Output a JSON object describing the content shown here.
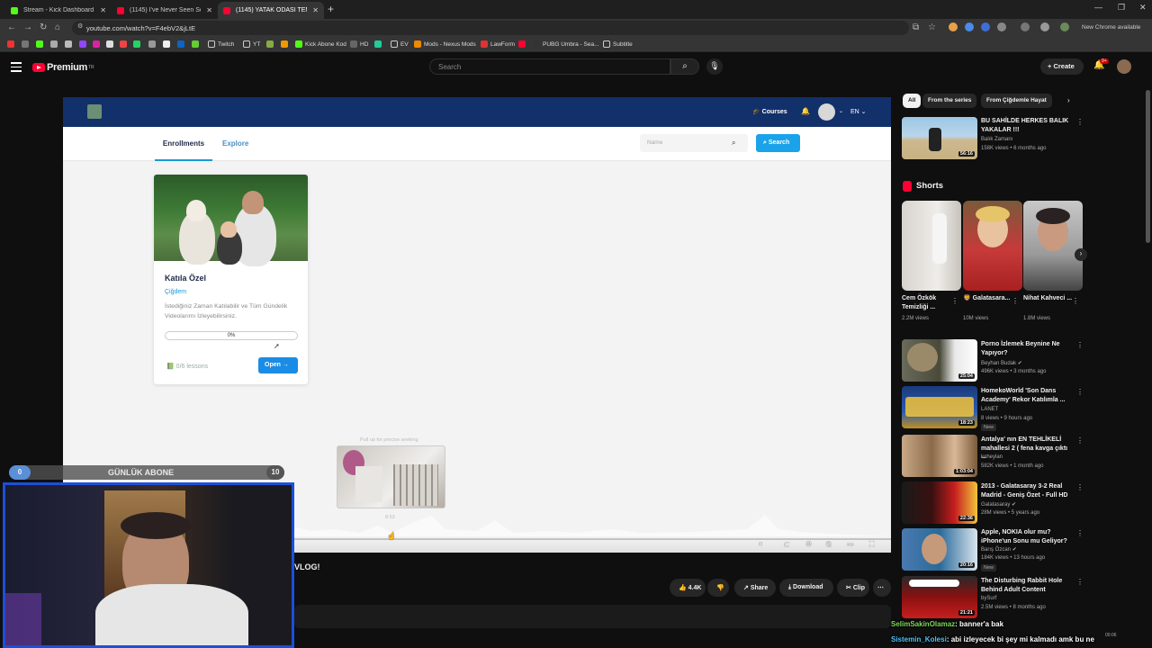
{
  "browser": {
    "tabs": [
      {
        "title": "Stream - Kick Dashboard",
        "color": "#53fc18",
        "active": false
      },
      {
        "title": "(1145) I've Never Seen So Man",
        "color": "#ff0033",
        "active": false
      },
      {
        "title": "(1145) YATAK ODASI TEMİZLİĞİ",
        "color": "#ff0033",
        "active": true
      }
    ],
    "new_tab": "+",
    "url": "youtube.com/watch?v=F4ebV2&jLtE",
    "chrome_update": "New Chrome available",
    "bookmarks": [
      "Twitch",
      "YT",
      "Kick Abone Kod",
      "HD",
      "EV",
      "Mods - Nexus Mods",
      "LawForm",
      "PUBG Umbra - Sea...",
      "Subtitle"
    ]
  },
  "youtube": {
    "logo_text": "Premium",
    "logo_region": "TR",
    "search_placeholder": "Search",
    "create_label": "+ Create",
    "notif_badge": "9+"
  },
  "lms": {
    "nav": {
      "courses": "Courses",
      "lang": "EN"
    },
    "tabs": {
      "enrollments": "Enrollments",
      "explore": "Explore"
    },
    "search_placeholder": "Name",
    "search_button": "Search",
    "card": {
      "title": "Katıla Özel",
      "author": "Çiğdem",
      "desc": "İstediğiniz Zaman Katılabilir ve Tüm Gündelik Videolarımı İzleyebilirsiniz.",
      "progress_label": "0%",
      "progress": 0,
      "lessons": "0/6 lessons",
      "open": "Open"
    }
  },
  "player": {
    "preview_time": "8:53",
    "preview_hint": "Pull up for precise seeking"
  },
  "video": {
    "title_fragment": "VLOG!",
    "actions": {
      "likes": "4.4K",
      "share": "Share",
      "download": "Download",
      "clip": "Clip"
    }
  },
  "sidebar": {
    "chips": [
      "All",
      "From the series",
      "From Çiğdemle Hayat"
    ],
    "top_video": {
      "title": "BU SAHİLDE HERKES BALIK YAKALAR !!!",
      "channel": "Balık Zamanı",
      "meta": "158K views • 6 months ago",
      "duration": "56:16"
    },
    "shorts_label": "Shorts",
    "shorts": [
      {
        "title": "Cem Özkök Temizliği ...",
        "views": "2.2M views"
      },
      {
        "title": "🦁 Galatasara...",
        "views": "10M views"
      },
      {
        "title": "Nihat Kahveci ...",
        "views": "1.8M views"
      }
    ],
    "videos": [
      {
        "title": "Porno İzlemek Beynine Ne Yapıyor?",
        "channel": "Beyhan Budak",
        "meta": "496K views • 3 months ago",
        "duration": "25:04",
        "new": ""
      },
      {
        "title": "HomekoWorld 'Son Dans Academy' Rekor Katılımla ...",
        "channel": "LANET",
        "meta": "8 views • 9 hours ago",
        "duration": "18:23",
        "new": "New"
      },
      {
        "title": "Antalya' nın EN TEHLİKELİ mahallesi 2 ( fena kavga çıktı ...",
        "channel": "koheylan",
        "meta": "582K views • 1 month ago",
        "duration": "1:03:04",
        "new": ""
      },
      {
        "title": "2013 - Galatasaray 3-2 Real Madrid - Geniş Özet - Full HD",
        "channel": "Galatasaray",
        "meta": "28M views • 5 years ago",
        "duration": "22:36",
        "new": ""
      },
      {
        "title": "Apple, NOKIA olur mu? iPhone'un Sonu mu Geliyor?",
        "channel": "Barış Özcan",
        "meta": "184K views • 13 hours ago",
        "duration": "20:16",
        "new": "New"
      },
      {
        "title": "The Disturbing Rabbit Hole Behind Adult Content",
        "channel": "bySurf",
        "meta": "2.5M views • 8 months ago",
        "duration": "21:21",
        "new": ""
      }
    ]
  },
  "overlay": {
    "sub_goal": {
      "left": "0",
      "label": "GÜNLÜK ABONE",
      "right": "10"
    },
    "chat": [
      {
        "user": "SelimSakinOlamaz",
        "msg": ": banner'a bak"
      },
      {
        "user": "Sistemin_Kolesi",
        "msg": ": abi izleyecek bi şey mi kalmadı amk bu ne"
      }
    ],
    "clock": "00:06"
  }
}
